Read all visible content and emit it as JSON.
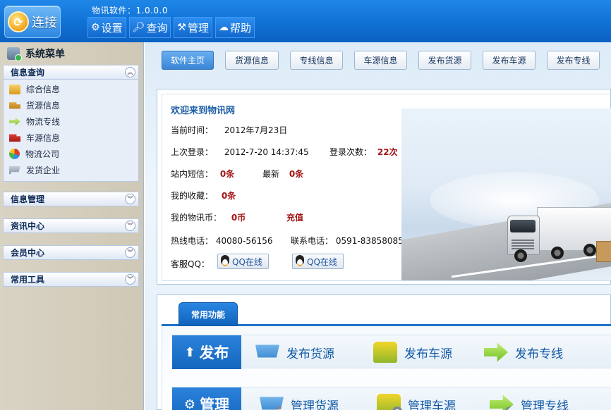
{
  "topbar": {
    "connect_label": "连接",
    "connect_icon": "logo-icon",
    "app_version": "物讯软件：1.0.0.0",
    "menu": [
      {
        "label": "设置",
        "icon": "gear-icon"
      },
      {
        "label": "查询",
        "icon": "search-icon"
      },
      {
        "label": "管理",
        "icon": "tools-icon"
      },
      {
        "label": "帮助",
        "icon": "help-icon"
      }
    ]
  },
  "sidebar": {
    "title": "系统菜单",
    "groups": [
      {
        "label": "信息查询",
        "expanded": true,
        "items": [
          {
            "label": "综合信息",
            "icon": "boxes-icon"
          },
          {
            "label": "货源信息",
            "icon": "truck-icon"
          },
          {
            "label": "物流专线",
            "icon": "arrow-icon"
          },
          {
            "label": "车源信息",
            "icon": "red-truck-icon"
          },
          {
            "label": "物流公司",
            "icon": "pie-icon"
          },
          {
            "label": "发货企业",
            "icon": "cart-icon"
          }
        ]
      },
      {
        "label": "信息管理",
        "expanded": false
      },
      {
        "label": "资讯中心",
        "expanded": false
      },
      {
        "label": "会员中心",
        "expanded": false
      },
      {
        "label": "常用工具",
        "expanded": false
      }
    ]
  },
  "tabs": [
    "软件主页",
    "货源信息",
    "专线信息",
    "车源信息",
    "发布货源",
    "发布车源",
    "发布专线"
  ],
  "active_tab": 0,
  "welcome": {
    "title": "欢迎来到物讯网",
    "current_time_label": "当前时间：",
    "current_time_value": "2012年7月23日",
    "last_login_label": "上次登录：",
    "last_login_value": "2012-7-20 14:37:45",
    "login_count_label": "登录次数：",
    "login_count_value": "22次",
    "sms_label": "站内短信：",
    "sms_value": "0条",
    "newest_label": "最新",
    "newest_value": "0条",
    "fav_label": "我的收藏：",
    "fav_value": "0条",
    "coin_label": "我的物讯币：",
    "coin_value": "0币",
    "recharge_label": "充值",
    "hotline_label": "热线电话：",
    "hotline_value": "40080-56156",
    "contact_label": "联系电话：",
    "contact_value": "0591-83858085",
    "qq_label": "客服QQ：",
    "qq_button_1": "QQ在线",
    "qq_button_2": "QQ在线"
  },
  "functions": {
    "tab_label": "常用功能",
    "publish": {
      "label": "发布",
      "items": [
        "发布货源",
        "发布车源",
        "发布专线"
      ]
    },
    "manage": {
      "label": "管理",
      "items": [
        "管理货源",
        "管理车源",
        "管理专线"
      ]
    }
  },
  "colors": {
    "topbar": "#0f6fd3",
    "accent": "#1c73c9",
    "value_red": "#a41515",
    "link_blue": "#135aa6"
  }
}
